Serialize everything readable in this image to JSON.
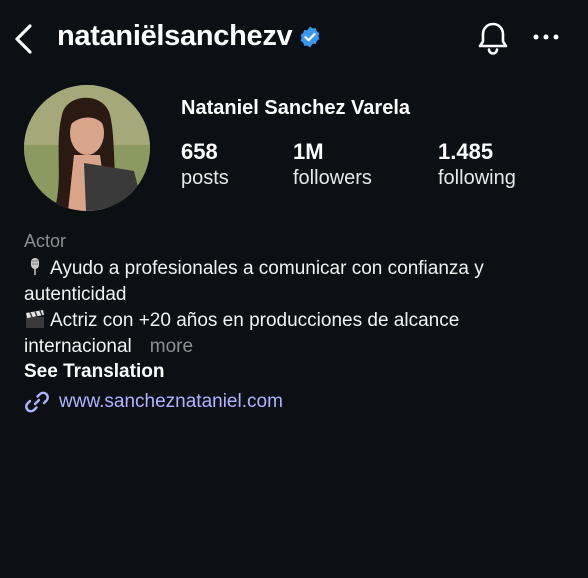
{
  "header": {
    "username": "nataniëlsanchezv",
    "back_icon": "chevron-left-icon",
    "verified_icon": "verified-badge-icon",
    "bell_icon": "bell-icon",
    "more_icon": "more-horizontal-icon"
  },
  "profile": {
    "display_name": "Nataniel Sanchez Varela",
    "stats": {
      "posts": {
        "value": "658",
        "label": "posts"
      },
      "followers": {
        "value": "1M",
        "label": "followers"
      },
      "following": {
        "value": "1.485",
        "label": "following"
      }
    },
    "category": "Actor",
    "bio_line1": "Ayudo a profesionales a comunicar con confianza y",
    "bio_line2": "autenticidad",
    "bio_line3": "Actriz con +20 años en producciones de alcance",
    "bio_line4": "internacional",
    "more_label": "more",
    "see_translation": "See Translation",
    "website": "www.sancheznataniel.com"
  },
  "colors": {
    "background": "#0c0f14",
    "verified": "#3897f0",
    "link": "#aeb4ff",
    "muted": "#8e8e93"
  }
}
